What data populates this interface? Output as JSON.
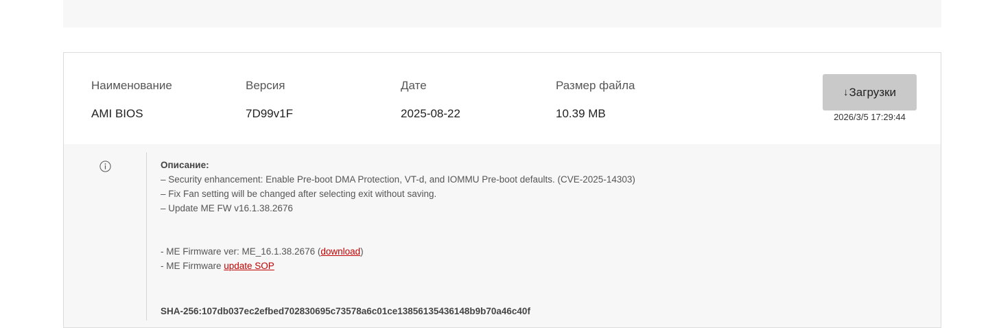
{
  "columns": {
    "name_label": "Наименование",
    "version_label": "Версия",
    "date_label": "Дате",
    "size_label": "Размер файла"
  },
  "row": {
    "name": "AMI BIOS",
    "version": "7D99v1F",
    "date": "2025-08-22",
    "size": "10.39 MB"
  },
  "download": {
    "icon_glyph": "↓",
    "label": "Загрузки",
    "timestamp": "2026/3/5 17:29:44"
  },
  "description": {
    "icon": "info-icon",
    "title": "Описание:",
    "lines": [
      "– Security enhancement: Enable Pre-boot DMA Protection, VT-d, and IOMMU Pre-boot defaults. (CVE-2025-14303)",
      "– Fix Fan setting will be changed after selecting exit without saving.",
      "– Update ME FW v16.1.38.2676"
    ],
    "me_firmware_prefix": "- ME Firmware ver: ME_16.1.38.2676 (",
    "me_firmware_link": "download",
    "me_firmware_suffix": ")",
    "sop_prefix": "- ME Firmware ",
    "sop_link": "update SOP",
    "sha": "SHA-256:107db037ec2efbed702830695c73578a6c01ce13856135436148b9b70a46c40f"
  },
  "colors": {
    "link": "#c00000",
    "button_bg": "#c9c9c9",
    "panel_bg": "#f7f7f7",
    "border": "#dcdcdc"
  }
}
